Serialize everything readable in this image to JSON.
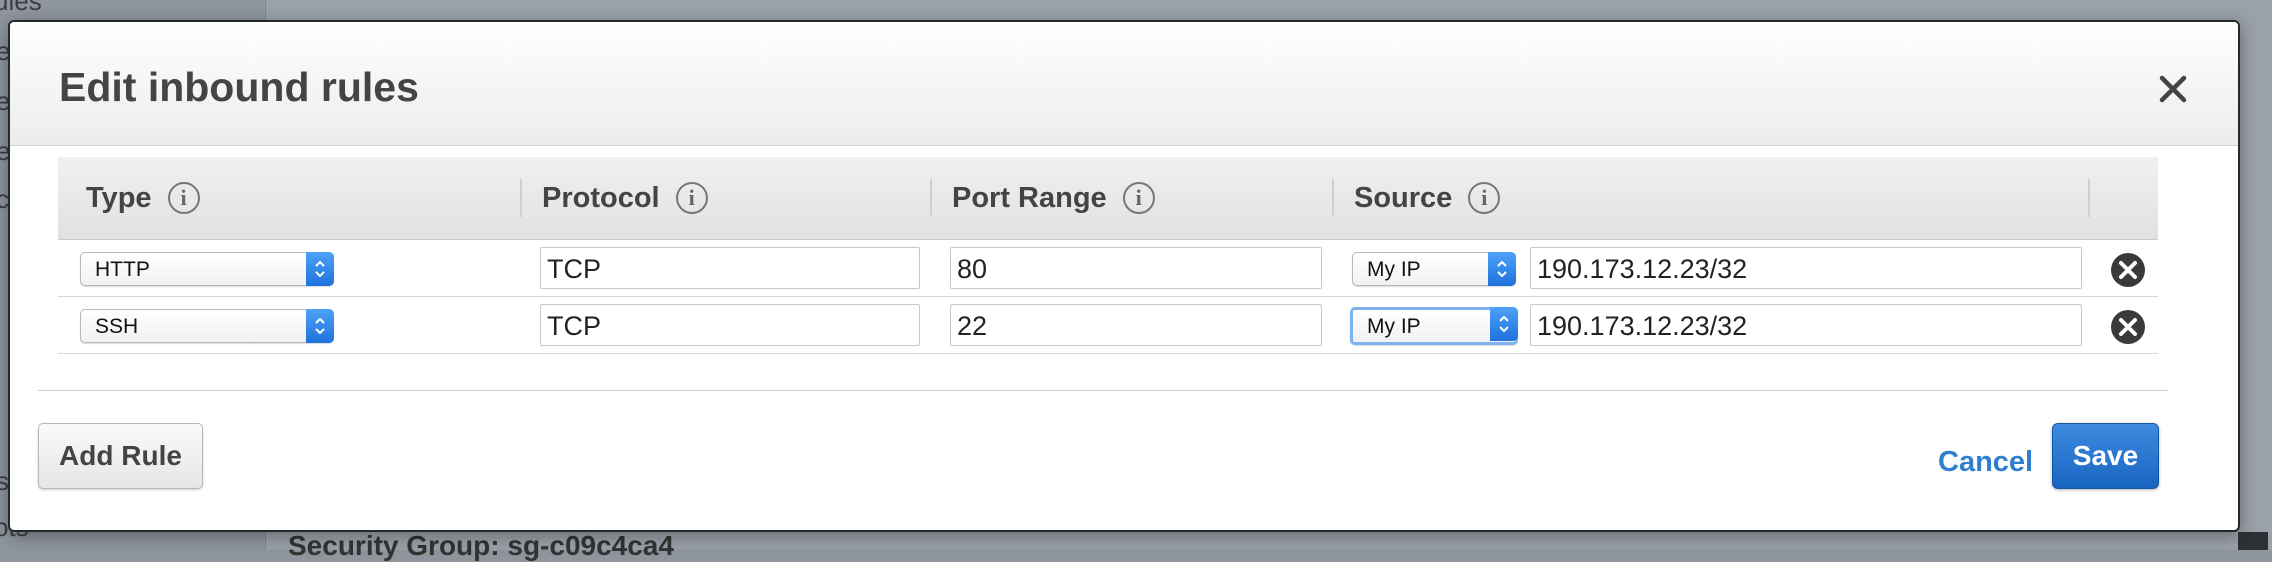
{
  "background": {
    "sidebar_fragments": [
      "ules",
      "e",
      "e",
      "e",
      "c",
      "s",
      "ots"
    ],
    "footer_text": "Security Group: sg-c09c4ca4"
  },
  "dialog": {
    "title": "Edit inbound rules",
    "close_icon": "close-icon",
    "columns": {
      "type": "Type",
      "protocol": "Protocol",
      "port_range": "Port Range",
      "source": "Source"
    },
    "info_glyph": "i",
    "rules": [
      {
        "type": "HTTP",
        "protocol": "TCP",
        "port_range": "80",
        "source_type": "My IP",
        "source_cidr": "190.173.12.23/32"
      },
      {
        "type": "SSH",
        "protocol": "TCP",
        "port_range": "22",
        "source_type": "My IP",
        "source_cidr": "190.173.12.23/32"
      }
    ],
    "add_rule_label": "Add Rule",
    "cancel_label": "Cancel",
    "save_label": "Save"
  },
  "colors": {
    "primary": "#1e6fce",
    "link": "#2f7fcf",
    "select_arrow": "#1e72dc"
  }
}
